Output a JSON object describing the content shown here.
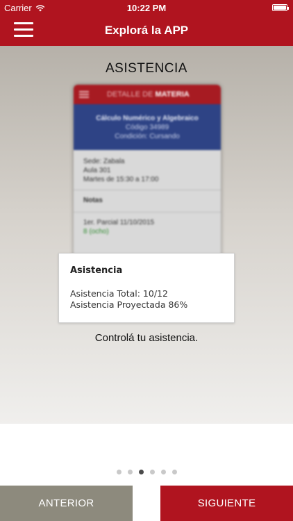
{
  "status_bar": {
    "carrier": "Carrier",
    "time": "10:22 PM"
  },
  "nav": {
    "title": "Explorá la APP",
    "menu_icon": "hamburger-menu-icon"
  },
  "page": {
    "section_title": "ASISTENCIA",
    "caption": "Controlá tu asistencia.",
    "current_page": 3,
    "total_pages": 6
  },
  "mockup": {
    "header_prefix": "DETALLE DE",
    "header_bold": "MATERIA",
    "subject_name": "Cálculo Numérico y Algebraico",
    "subject_code": "Código 34989",
    "subject_condition": "Condición: Cursando",
    "sede": "Sede: Zabala",
    "aula": "Aula 301",
    "horario": "Martes de 15:30 a 17:00",
    "notas_label": "Notas",
    "parcial": "1er. Parcial 11/10/2015",
    "grade": "8 (ocho)"
  },
  "card": {
    "title": "Asistencia",
    "line1": "Asistencia Total: 10/12",
    "line2": "Asistencia Proyectada 86%"
  },
  "buttons": {
    "prev": "ANTERIOR",
    "next": "SIGUIENTE"
  },
  "colors": {
    "brand_red": "#b0141f",
    "prev_button": "#8d8a7d",
    "mock_blue": "#2e4385"
  }
}
